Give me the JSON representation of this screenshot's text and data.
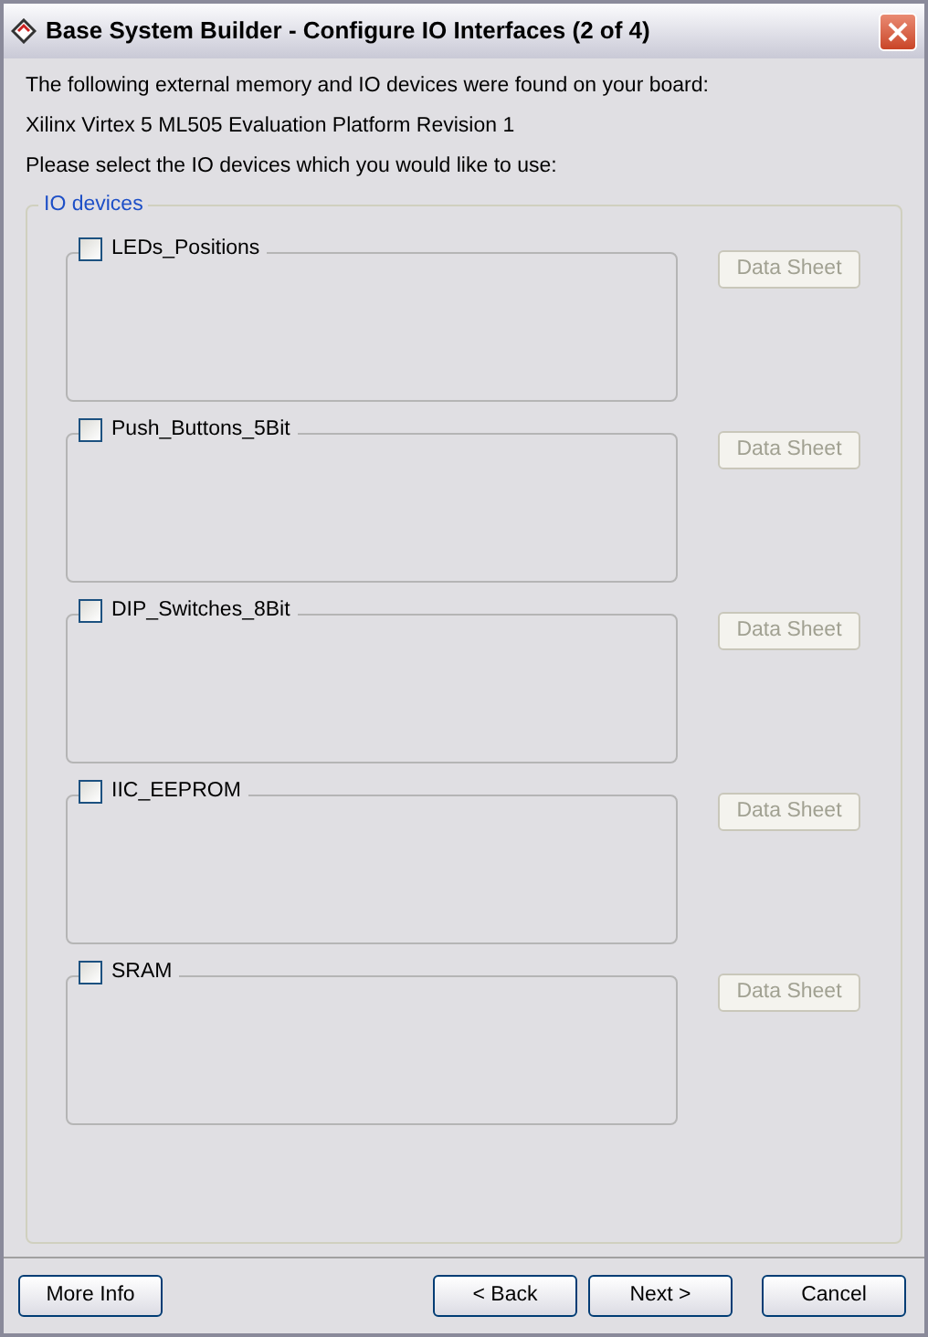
{
  "window": {
    "title": "Base System Builder - Configure IO Interfaces (2 of 4)"
  },
  "intro": [
    "The following external memory and IO devices were found on your board:",
    "Xilinx Virtex 5 ML505 Evaluation Platform Revision 1",
    "Please select the IO devices which you would like to use:"
  ],
  "group": {
    "title": "IO devices"
  },
  "devices": [
    {
      "name": "LEDs_Positions",
      "checked": false,
      "button": {
        "label": "Data Sheet",
        "disabled": true
      }
    },
    {
      "name": "Push_Buttons_5Bit",
      "checked": false,
      "button": {
        "label": "Data Sheet",
        "disabled": true
      }
    },
    {
      "name": "DIP_Switches_8Bit",
      "checked": false,
      "button": {
        "label": "Data Sheet",
        "disabled": true
      }
    },
    {
      "name": "IIC_EEPROM",
      "checked": false,
      "button": {
        "label": "Data Sheet",
        "disabled": true
      }
    },
    {
      "name": "SRAM",
      "checked": false,
      "button": {
        "label": "Data Sheet",
        "disabled": true
      }
    }
  ],
  "footer": {
    "buttons": [
      "More Info",
      "< Back",
      "Next >",
      "Cancel"
    ]
  }
}
